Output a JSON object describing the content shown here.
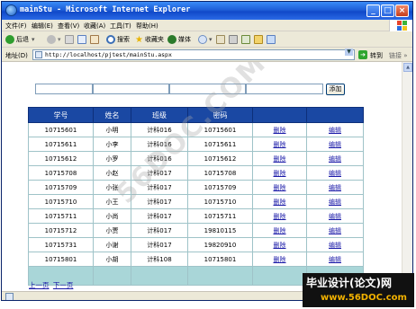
{
  "window": {
    "title": "mainStu - Microsoft Internet Explorer",
    "min_label": "_",
    "max_label": "□",
    "close_label": "×"
  },
  "menubar": [
    "文件(F)",
    "编辑(E)",
    "查看(V)",
    "收藏(A)",
    "工具(T)",
    "帮助(H)"
  ],
  "toolbar": {
    "back": "后退",
    "search": "搜索",
    "favorites": "收藏夹",
    "media": "媒体"
  },
  "address": {
    "label": "地址(D)",
    "url": "http://localhost/pjtest/mainStu.aspx",
    "go": "转到",
    "links": "链接 »"
  },
  "form": {
    "add_button": "添加"
  },
  "table": {
    "headers": [
      "学号",
      "姓名",
      "班级",
      "密码",
      "",
      ""
    ],
    "rows": [
      {
        "id": "10715601",
        "name": "小明",
        "class": "计科016",
        "password": "10715601",
        "delete": "删除",
        "edit": "编辑"
      },
      {
        "id": "10715611",
        "name": "小李",
        "class": "计科016",
        "password": "10715611",
        "delete": "删除",
        "edit": "编辑"
      },
      {
        "id": "10715612",
        "name": "小罗",
        "class": "计科016",
        "password": "10715612",
        "delete": "删除",
        "edit": "编辑"
      },
      {
        "id": "10715708",
        "name": "小赵",
        "class": "计科017",
        "password": "10715708",
        "delete": "删除",
        "edit": "编辑"
      },
      {
        "id": "10715709",
        "name": "小张",
        "class": "计科017",
        "password": "10715709",
        "delete": "删除",
        "edit": "编辑"
      },
      {
        "id": "10715710",
        "name": "小王",
        "class": "计科017",
        "password": "10715710",
        "delete": "删除",
        "edit": "编辑"
      },
      {
        "id": "10715711",
        "name": "小尚",
        "class": "计科017",
        "password": "10715711",
        "delete": "删除",
        "edit": "编辑"
      },
      {
        "id": "10715712",
        "name": "小贾",
        "class": "计科017",
        "password": "19810115",
        "delete": "删除",
        "edit": "编辑"
      },
      {
        "id": "10715731",
        "name": "小谢",
        "class": "计科017",
        "password": "19820910",
        "delete": "删除",
        "edit": "编辑"
      },
      {
        "id": "10715801",
        "name": "小胡",
        "class": "计科108",
        "password": "10715801",
        "delete": "删除",
        "edit": "编辑"
      }
    ]
  },
  "pager": {
    "prev": "上一页",
    "next": "下一页"
  },
  "watermark": {
    "diagonal": "56DOC.COM",
    "brand_line1": "毕业设计(论文)网",
    "brand_line2": "www.56DOC.com"
  },
  "colors": {
    "header_bg": "#1a48a3",
    "footer_row_bg": "#a9d6d8",
    "link": "#1a1aa8",
    "titlebar": "#1e5fd8"
  }
}
